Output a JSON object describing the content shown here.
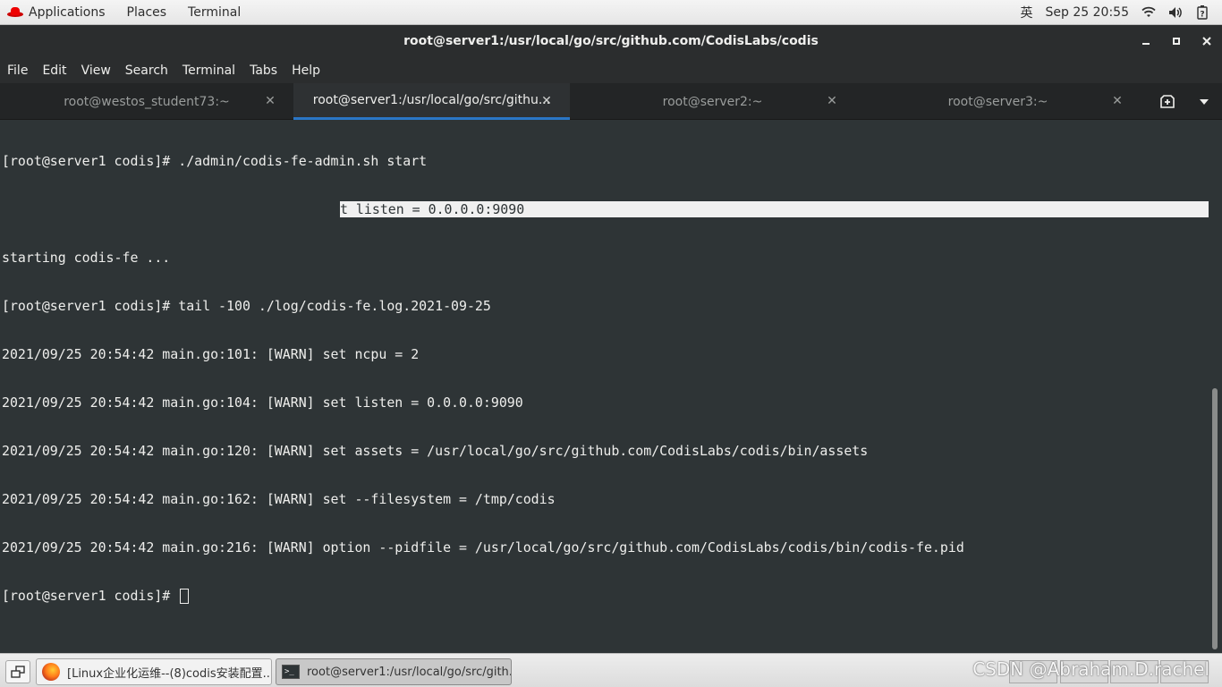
{
  "top_panel": {
    "applications": "Applications",
    "places": "Places",
    "terminal": "Terminal",
    "input_method": "英",
    "clock": "Sep 25  20:55"
  },
  "window": {
    "title": "root@server1:/usr/local/go/src/github.com/CodisLabs/codis",
    "minimize": "‒",
    "maximize": "□",
    "close": "✕"
  },
  "menubar": [
    "File",
    "Edit",
    "View",
    "Search",
    "Terminal",
    "Tabs",
    "Help"
  ],
  "tabs": [
    {
      "label": "root@westos_student73:~",
      "active": false
    },
    {
      "label": "root@server1:/usr/local/go/src/githu...",
      "active": true
    },
    {
      "label": "root@server2:~",
      "active": false
    },
    {
      "label": "root@server3:~",
      "active": false
    }
  ],
  "terminal": {
    "lines": [
      "[root@server1 codis]# ./admin/codis-fe-admin.sh start",
      "",
      "starting codis-fe ...",
      "[root@server1 codis]# tail -100 ./log/codis-fe.log.2021-09-25",
      "2021/09/25 20:54:42 main.go:101: [WARN] set ncpu = 2",
      "2021/09/25 20:54:42 main.go:104: [WARN] set listen = 0.0.0.0:9090",
      "2021/09/25 20:54:42 main.go:120: [WARN] set assets = /usr/local/go/src/github.com/CodisLabs/codis/bin/assets",
      "2021/09/25 20:54:42 main.go:162: [WARN] set --filesystem = /tmp/codis",
      "2021/09/25 20:54:42 main.go:216: [WARN] option --pidfile = /usr/local/go/src/github.com/CodisLabs/codis/bin/codis-fe.pid"
    ],
    "prompt": "[root@server1 codis]# ",
    "selected_text": "t listen = 0.0.0.0:9090"
  },
  "taskbar": {
    "tasks": [
      {
        "label": "[Linux企业化运维--(8)codis安装配置...",
        "icon": "firefox-icon"
      },
      {
        "label": "root@server1:/usr/local/go/src/gith...",
        "icon": "terminal-icon"
      }
    ],
    "watermark": "CSDN @Abraham.D.rachel"
  }
}
